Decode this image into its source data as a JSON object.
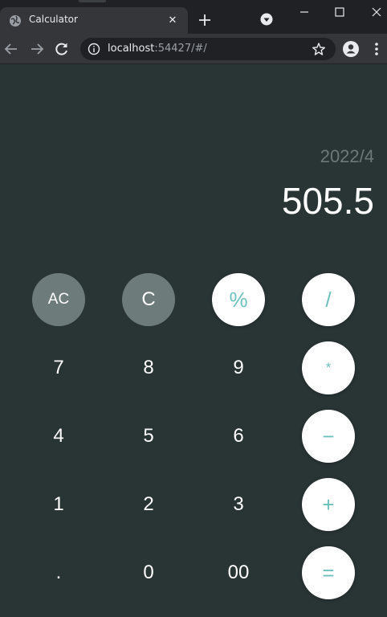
{
  "browser": {
    "tab_title": "Calculator",
    "tab_close": "✕",
    "url_host": "localhost",
    "url_rest": ":54427/#/"
  },
  "calculator": {
    "expression": "2022/4",
    "result": "505.5",
    "keys": {
      "ac": "AC",
      "c": "C",
      "percent": "%",
      "divide": "/",
      "seven": "7",
      "eight": "8",
      "nine": "9",
      "multiply": "*",
      "four": "4",
      "five": "5",
      "six": "6",
      "minus": "−",
      "one": "1",
      "two": "2",
      "three": "3",
      "plus": "+",
      "dot": ".",
      "zero": "0",
      "double_zero": "00",
      "equals": "="
    },
    "colors": {
      "background": "#293435",
      "function_key": "#6d7b7b",
      "operator_key_bg": "#ffffff",
      "operator_key_text": "#6cc1bd",
      "expression_text": "#6d7878",
      "result_text": "#ffffff"
    }
  },
  "icons": [
    "globe-icon",
    "close-icon",
    "plus-icon",
    "tab-search-icon",
    "minimize-icon",
    "maximize-icon",
    "window-close-icon",
    "back-arrow-icon",
    "forward-arrow-icon",
    "reload-icon",
    "info-icon",
    "star-icon",
    "profile-icon",
    "more-vert-icon"
  ]
}
